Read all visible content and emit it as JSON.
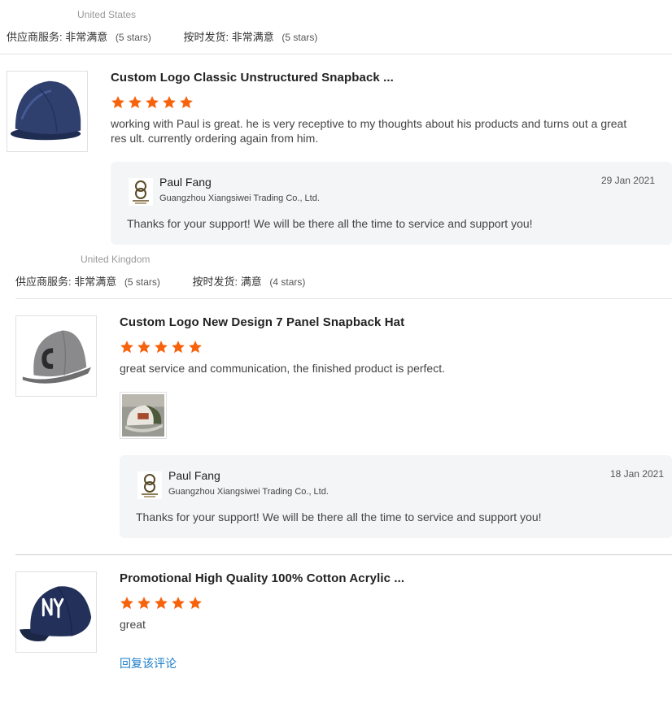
{
  "reviews": [
    {
      "country": "United States",
      "supplier_service_label": "供应商服务:",
      "supplier_service_value": "非常满意",
      "supplier_service_stars": "(5 stars)",
      "on_time_label": "按时发货:",
      "on_time_value": "非常满意",
      "on_time_stars": "(5 stars)",
      "product_title": "Custom Logo Classic Unstructured Snapback ...",
      "rating": 5,
      "comment": "working with Paul is great. he is very receptive to my thoughts about his products and turns out a great res ult. currently ordering again from him.",
      "reply": {
        "name": "Paul Fang",
        "company": "Guangzhou Xiangsiwei Trading Co., Ltd.",
        "date": "29 Jan 2021",
        "text": "Thanks for your support! We will be there all the time to service and support you!"
      }
    },
    {
      "country": "United Kingdom",
      "supplier_service_label": "供应商服务:",
      "supplier_service_value": "非常满意",
      "supplier_service_stars": "(5 stars)",
      "on_time_label": "按时发货:",
      "on_time_value": "满意",
      "on_time_stars": "(4 stars)",
      "product_title": "Custom Logo New Design 7 Panel Snapback Hat",
      "rating": 5,
      "comment": "great service and communication, the finished product is perfect.",
      "reply": {
        "name": "Paul Fang",
        "company": "Guangzhou Xiangsiwei Trading Co., Ltd.",
        "date": "18 Jan 2021",
        "text": "Thanks for your support! We will be there all the time to service and support you!"
      }
    },
    {
      "product_title": "Promotional High Quality 100% Cotton Acrylic ...",
      "rating": 5,
      "comment": "great",
      "reply_link": "回复该评论"
    }
  ],
  "colors": {
    "star": "#f7630c",
    "link": "#1a7cc9",
    "reply_bg": "#f4f5f7"
  },
  "icons": {
    "star": "star-icon",
    "avatar": "supplier-logo-icon"
  }
}
